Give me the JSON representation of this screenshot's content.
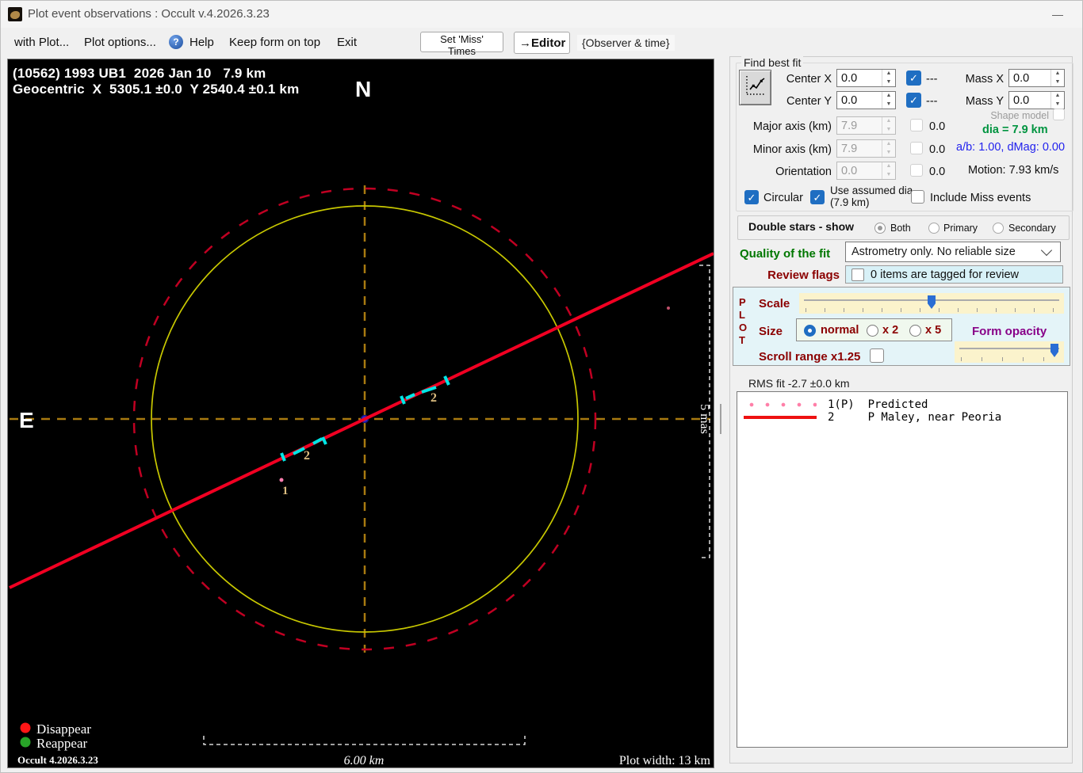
{
  "window": {
    "title": "Plot event observations : Occult v.4.2026.3.23",
    "minimize_glyph": "—"
  },
  "menu": {
    "with_plot": "with Plot...",
    "plot_options": "Plot options...",
    "help": "Help",
    "help_glyph": "?",
    "keep_on_top": "Keep form on top",
    "exit": "Exit",
    "set_miss_times": "Set 'Miss' Times",
    "editor": "→Editor",
    "observer_time": "{Observer & time}"
  },
  "plot": {
    "title_line1": "(10562) 1993 UB1  2026 Jan 10   7.9 km",
    "title_line2": "Geocentric  X  5305.1 ±0.0  Y 2540.4 ±0.1 km",
    "north": "N",
    "east": "E",
    "scale_vertical": "5 mas",
    "scale_horizontal": "6.00 km",
    "plot_width": "Plot width: 13 km",
    "disappear": "Disappear",
    "reappear": "Reappear",
    "version": "Occult 4.2026.3.23",
    "chord_label_upper": "2",
    "chord_label_lower": "2",
    "predicted_label": "1"
  },
  "find_best_fit": {
    "title": "Find best fit",
    "center_x_label": "Center X",
    "center_x_value": "0.0",
    "center_y_label": "Center Y",
    "center_y_value": "0.0",
    "mass_x_label": "Mass X",
    "mass_x_value": "0.0",
    "mass_y_label": "Mass Y",
    "mass_y_value": "0.0",
    "dash_x": "---",
    "dash_y": "---",
    "shape_model_label": "Shape model",
    "major_axis_label": "Major axis (km)",
    "major_axis_value": "7.9",
    "major_axis_cb_value": "0.0",
    "minor_axis_label": "Minor axis (km)",
    "minor_axis_value": "7.9",
    "minor_axis_cb_value": "0.0",
    "orientation_label": "Orientation",
    "orientation_value": "0.0",
    "orientation_cb_value": "0.0",
    "dia_text": "dia = 7.9 km",
    "ab_text": "a/b: 1.00, dMag: 0.00",
    "motion_text": "Motion: 7.93 km/s",
    "circular_label": "Circular",
    "use_assumed_label": "Use assumed dia (7.9 km)",
    "include_miss_label": "Include Miss events"
  },
  "double_stars": {
    "title": "Double stars - show",
    "option_both": "Both",
    "option_primary": "Primary",
    "option_secondary": "Secondary",
    "selected": "Both"
  },
  "quality": {
    "label": "Quality of the fit",
    "value": "Astrometry only. No reliable size"
  },
  "review": {
    "label": "Review flags",
    "text": "0 items are tagged for review"
  },
  "plot_controls": {
    "vertical_label": "PLOT",
    "scale_label": "Scale",
    "size_label": "Size",
    "size_normal": "normal",
    "size_x2": "x 2",
    "size_x5": "x 5",
    "size_selected": "normal",
    "form_opacity_label": "Form opacity",
    "scroll_range_label": "Scroll range x1.25"
  },
  "rms_fit": "RMS fit -2.7 ±0.0 km",
  "legend_list": {
    "entries": [
      {
        "swatch": "dotted-red",
        "text": "1(P)  Predicted"
      },
      {
        "swatch": "solid-red",
        "text": "2     P Maley, near Peoria"
      }
    ]
  },
  "colors": {
    "accent_blue": "#1f6ec2",
    "chord_red": "#f10022",
    "dashed_circle_red": "#c00022",
    "circle_yellow": "#c8c800",
    "marker_cyan": "#00e6e6",
    "crosshair_orange": "#a87a10",
    "panel_cyan": "#e4f4f8",
    "slider_cream": "#fbf3cc",
    "green_text": "#009440",
    "blue_text": "#2222ee",
    "maroon_text": "#8b0000",
    "purple_text": "#880088"
  }
}
